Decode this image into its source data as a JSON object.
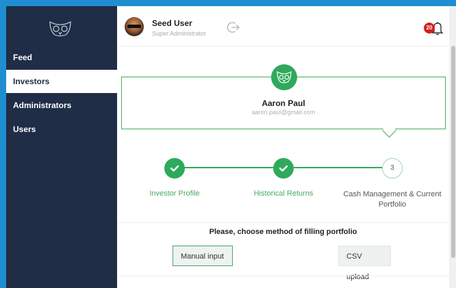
{
  "sidebar": {
    "logo_icon": "owl-icon",
    "items": [
      {
        "label": "Feed",
        "active": false
      },
      {
        "label": "Investors",
        "active": true
      },
      {
        "label": "Administrators",
        "active": false
      },
      {
        "label": "Users",
        "active": false
      }
    ]
  },
  "header": {
    "user_name": "Seed User",
    "user_role": "Super Administrator",
    "notification_count": "20",
    "logout_icon": "logout-icon",
    "bell_icon": "bell-icon"
  },
  "investor": {
    "name": "Aaron Paul",
    "email": "aaron.paul@gmail.com"
  },
  "steps": [
    {
      "label": "Investor Profile",
      "status": "done"
    },
    {
      "label": "Historical Returns",
      "status": "done"
    },
    {
      "label": "Cash Management & Current Portfolio",
      "number": "3",
      "status": "current"
    }
  ],
  "method": {
    "title": "Please, choose method of filling portfolio",
    "manual_label": "Manual input",
    "csv_label": "CSV upload"
  },
  "colors": {
    "sidebar_bg": "#1f2d47",
    "accent_green": "#2eaa5c",
    "badge_red": "#d6201f",
    "frame_blue": "#1f8ed0"
  }
}
